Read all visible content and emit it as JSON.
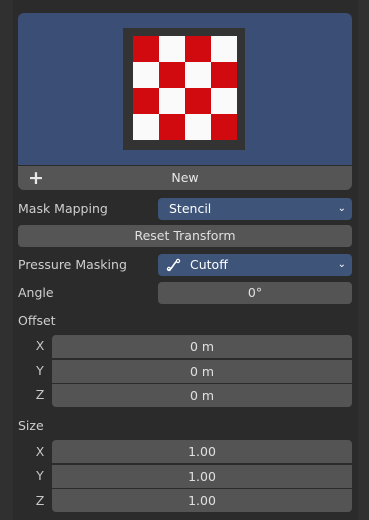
{
  "new_button": {
    "label": "New",
    "icon": "plus-icon"
  },
  "mask_mapping": {
    "label": "Mask Mapping",
    "value": "Stencil"
  },
  "reset_transform": {
    "label": "Reset Transform"
  },
  "pressure_masking": {
    "label": "Pressure Masking",
    "value": "Cutoff",
    "icon": "curve-icon"
  },
  "angle": {
    "label": "Angle",
    "value": "0°"
  },
  "offset": {
    "label": "Offset",
    "rows": [
      {
        "axis": "X",
        "value": "0 m"
      },
      {
        "axis": "Y",
        "value": "0 m"
      },
      {
        "axis": "Z",
        "value": "0 m"
      }
    ]
  },
  "size": {
    "label": "Size",
    "rows": [
      {
        "axis": "X",
        "value": "1.00"
      },
      {
        "axis": "Y",
        "value": "1.00"
      },
      {
        "axis": "Z",
        "value": "1.00"
      }
    ]
  },
  "colors": {
    "accent": "#3e5479",
    "preview_bg": "#3b4f76",
    "checker_red": "#d10a10"
  }
}
